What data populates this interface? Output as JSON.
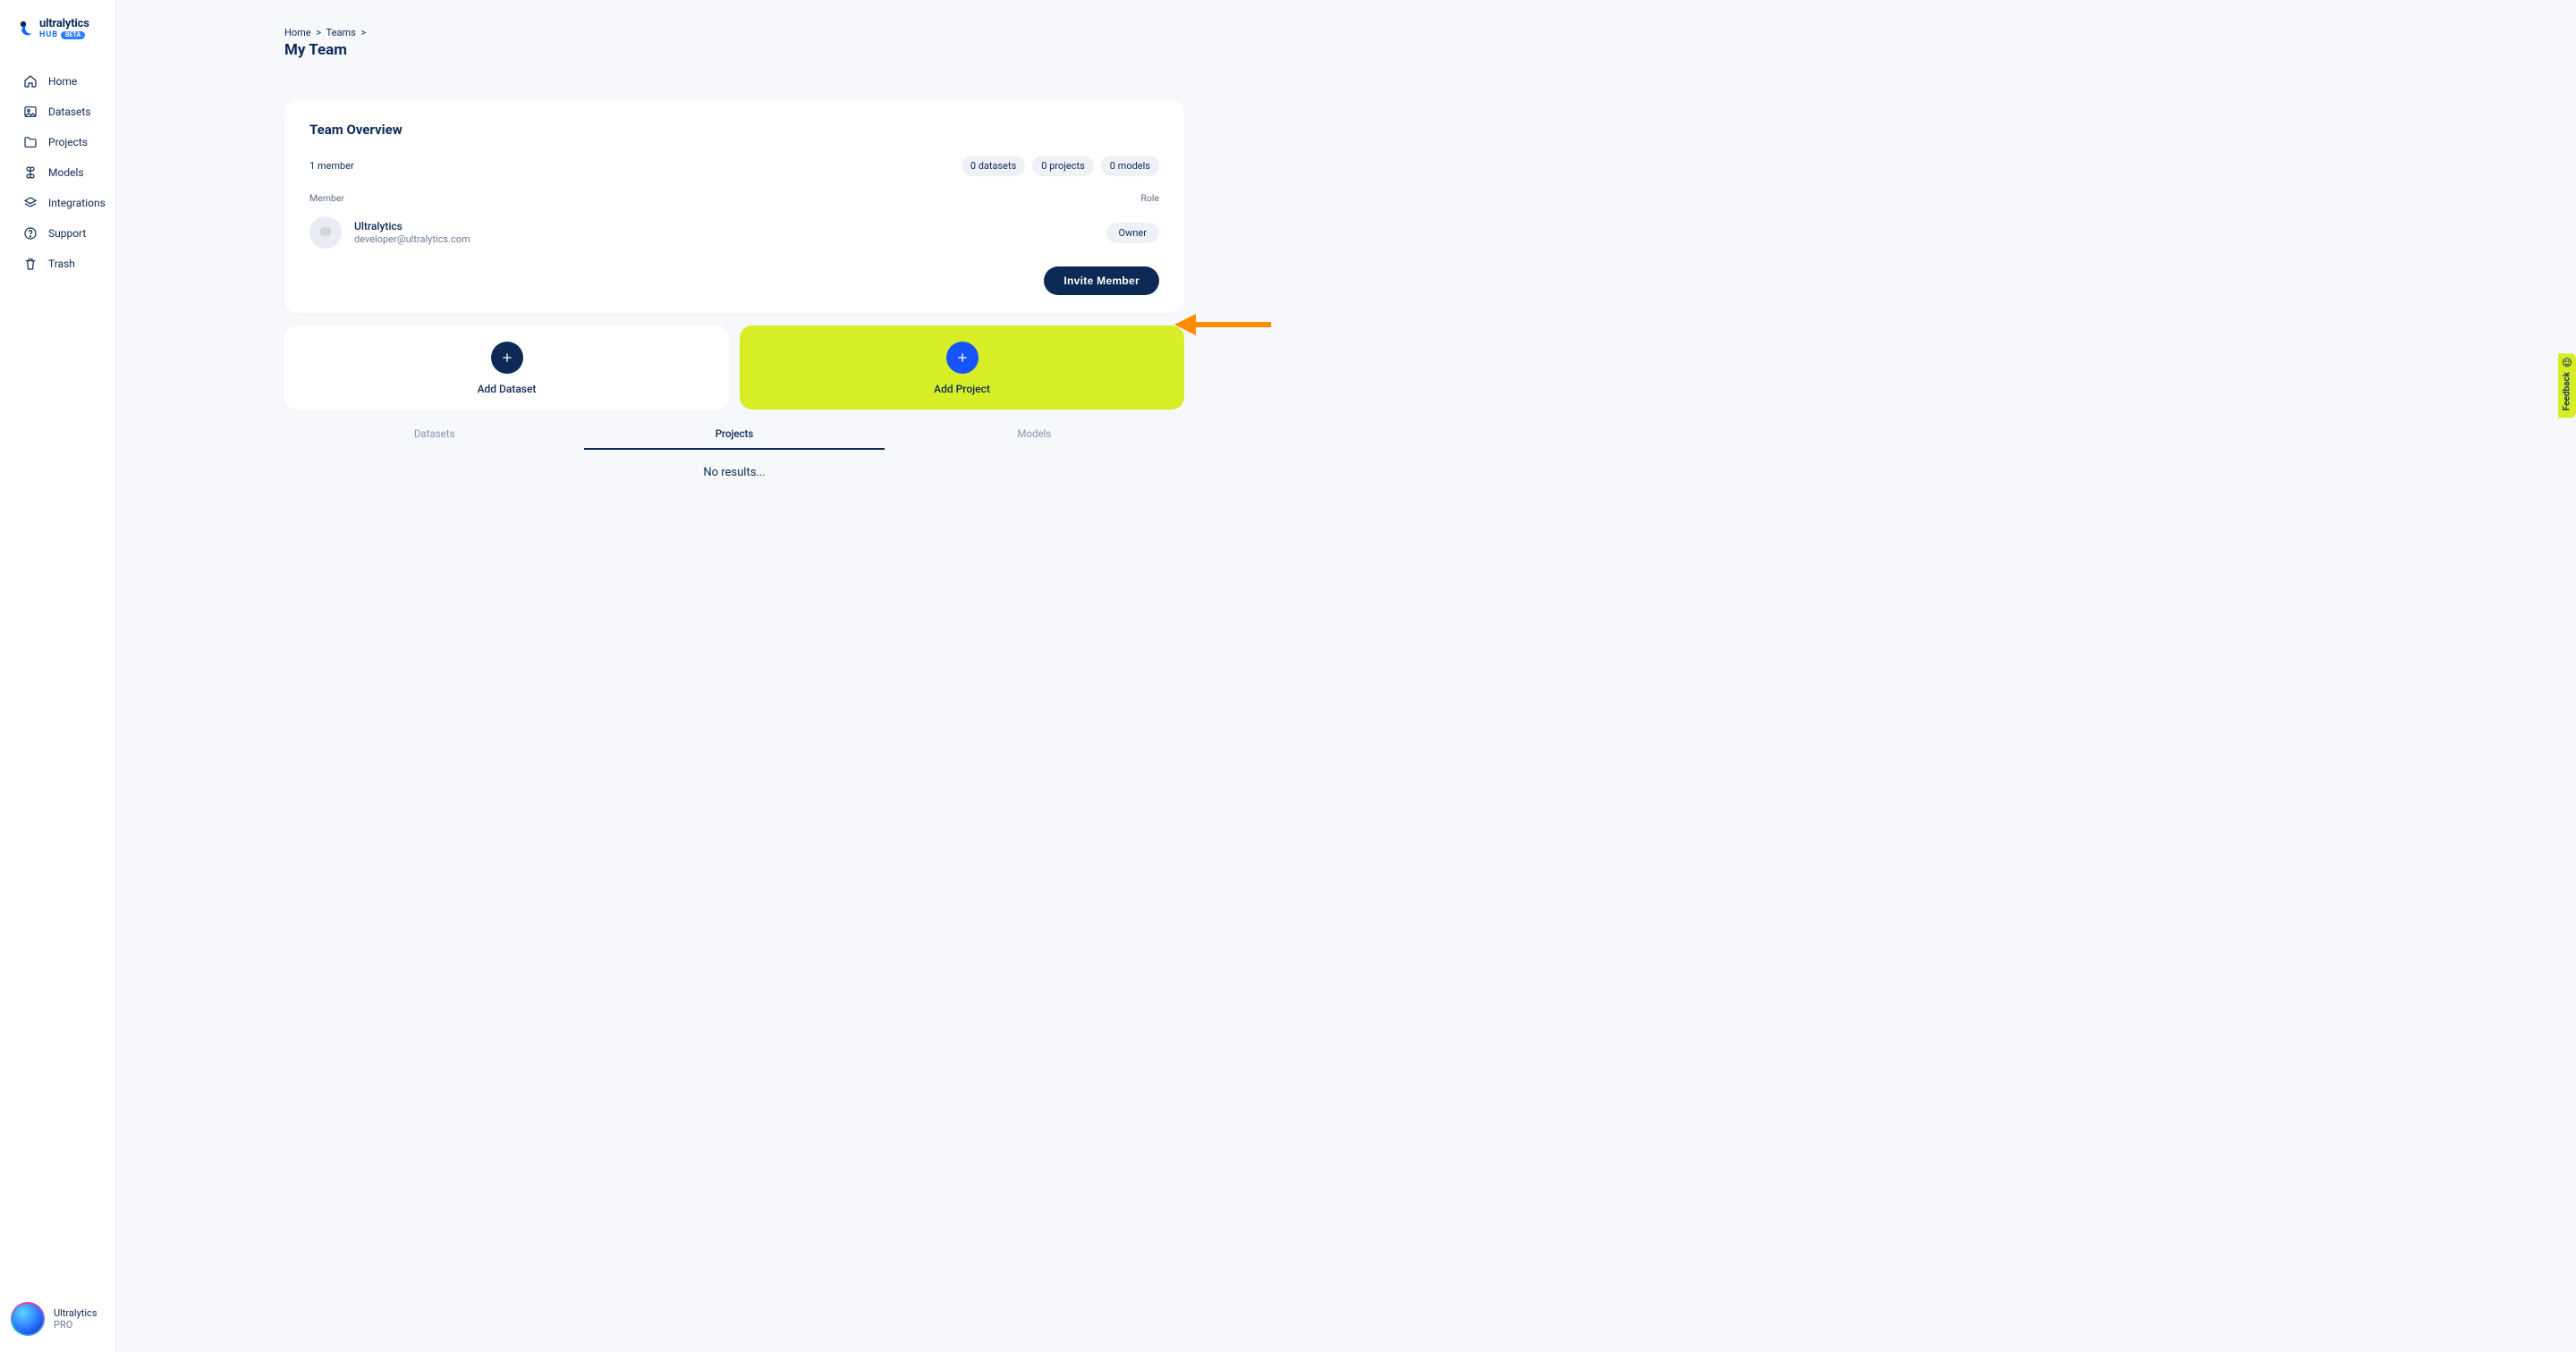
{
  "brand": {
    "name": "ultralytics",
    "hub": "HUB",
    "beta": "BETA"
  },
  "nav": {
    "home": "Home",
    "datasets": "Datasets",
    "projects": "Projects",
    "models": "Models",
    "integrations": "Integrations",
    "support": "Support",
    "trash": "Trash"
  },
  "user": {
    "name": "Ultralytics",
    "plan": "PRO"
  },
  "breadcrumb": {
    "home": "Home",
    "teams": "Teams"
  },
  "page_title": "My Team",
  "overview": {
    "title": "Team Overview",
    "member_count": "1 member",
    "chips": {
      "datasets": "0 datasets",
      "projects": "0 projects",
      "models": "0 models"
    },
    "col_member": "Member",
    "col_role": "Role",
    "member": {
      "name": "Ultralytics",
      "email": "developer@ultralytics.com",
      "role": "Owner"
    },
    "invite_label": "Invite Member"
  },
  "add": {
    "dataset": "Add Dataset",
    "project": "Add Project"
  },
  "tabs": {
    "datasets": "Datasets",
    "projects": "Projects",
    "models": "Models"
  },
  "no_results": "No results...",
  "feedback": "Feedback"
}
